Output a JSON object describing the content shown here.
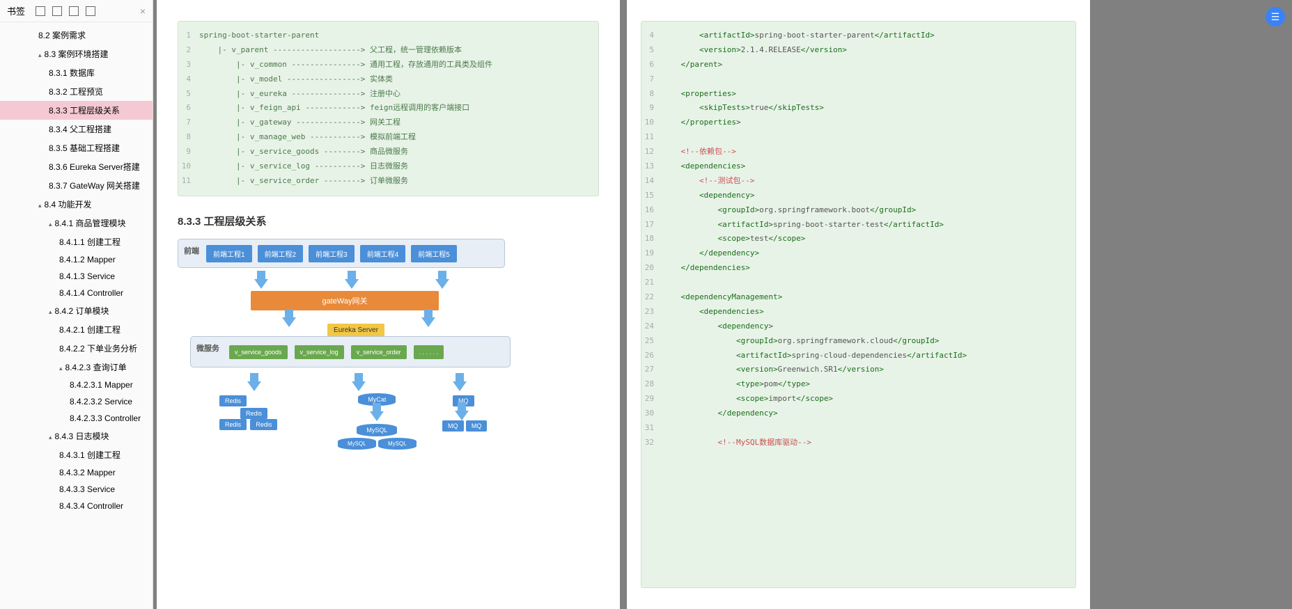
{
  "sidebar": {
    "title": "书签",
    "items": [
      {
        "label": "8.2 案例需求",
        "indent": 1,
        "caret": false
      },
      {
        "label": "8.3 案例环境搭建",
        "indent": 1,
        "caret": true
      },
      {
        "label": "8.3.1 数据库",
        "indent": 2,
        "caret": false
      },
      {
        "label": "8.3.2 工程预览",
        "indent": 2,
        "caret": false
      },
      {
        "label": "8.3.3 工程层级关系",
        "indent": 2,
        "caret": false,
        "active": true
      },
      {
        "label": "8.3.4 父工程搭建",
        "indent": 2,
        "caret": false
      },
      {
        "label": "8.3.5 基础工程搭建",
        "indent": 2,
        "caret": false
      },
      {
        "label": "8.3.6 Eureka Server搭建",
        "indent": 2,
        "caret": false
      },
      {
        "label": "8.3.7 GateWay 网关搭建",
        "indent": 2,
        "caret": false
      },
      {
        "label": "8.4 功能开发",
        "indent": 1,
        "caret": true
      },
      {
        "label": "8.4.1 商品管理模块",
        "indent": 2,
        "caret": true
      },
      {
        "label": "8.4.1.1 创建工程",
        "indent": 3,
        "caret": false
      },
      {
        "label": "8.4.1.2 Mapper",
        "indent": 3,
        "caret": false
      },
      {
        "label": "8.4.1.3 Service",
        "indent": 3,
        "caret": false
      },
      {
        "label": "8.4.1.4 Controller",
        "indent": 3,
        "caret": false
      },
      {
        "label": "8.4.2 订单模块",
        "indent": 2,
        "caret": true
      },
      {
        "label": "8.4.2.1 创建工程",
        "indent": 3,
        "caret": false
      },
      {
        "label": "8.4.2.2 下单业务分析",
        "indent": 3,
        "caret": false
      },
      {
        "label": "8.4.2.3 查询订单",
        "indent": 3,
        "caret": true
      },
      {
        "label": "8.4.2.3.1 Mapper",
        "indent": 4,
        "caret": false
      },
      {
        "label": "8.4.2.3.2 Service",
        "indent": 4,
        "caret": false
      },
      {
        "label": "8.4.2.3.3 Controller",
        "indent": 4,
        "caret": false
      },
      {
        "label": "8.4.3 日志模块",
        "indent": 2,
        "caret": true
      },
      {
        "label": "8.4.3.1 创建工程",
        "indent": 3,
        "caret": false
      },
      {
        "label": "8.4.3.2 Mapper",
        "indent": 3,
        "caret": false
      },
      {
        "label": "8.4.3.3 Service",
        "indent": 3,
        "caret": false
      },
      {
        "label": "8.4.3.4 Controller",
        "indent": 3,
        "caret": false
      }
    ]
  },
  "left_code": [
    {
      "n": "1",
      "t": "spring-boot-starter-parent"
    },
    {
      "n": "2",
      "t": "    |- v_parent -------------------> 父工程，统一管理依赖版本"
    },
    {
      "n": "3",
      "t": "        |- v_common ---------------> 通用工程，存放通用的工具类及组件"
    },
    {
      "n": "4",
      "t": "        |- v_model ----------------> 实体类"
    },
    {
      "n": "5",
      "t": "        |- v_eureka ---------------> 注册中心"
    },
    {
      "n": "6",
      "t": "        |- v_feign_api ------------> feign远程调用的客户端接口"
    },
    {
      "n": "7",
      "t": "        |- v_gateway --------------> 网关工程"
    },
    {
      "n": "8",
      "t": "        |- v_manage_web -----------> 模拟前端工程"
    },
    {
      "n": "9",
      "t": "        |- v_service_goods --------> 商品微服务"
    },
    {
      "n": "10",
      "t": "        |- v_service_log ----------> 日志微服务"
    },
    {
      "n": "11",
      "t": "        |- v_service_order --------> 订单微服务"
    }
  ],
  "section_title": "8.3.3 工程层级关系",
  "diagram": {
    "frontend_label": "前端",
    "frontend_boxes": [
      "前端工程1",
      "前端工程2",
      "前端工程3",
      "前端工程4",
      "前端工程5"
    ],
    "gateway": "gateWay网关",
    "eureka": "Eureka Server",
    "micro_label": "微服务",
    "services": [
      "v_service_goods",
      "v_service_log",
      "v_service_order",
      ". . . . . ."
    ],
    "redis": "Redis",
    "mycat": "MyCat",
    "mysql": "MySQL",
    "mq": "MQ"
  },
  "right_code": [
    {
      "n": "4",
      "html": "        <span class='tag'>&lt;artifactId&gt;</span><span class='text'>spring-boot-starter-parent</span><span class='tag'>&lt;/artifactId&gt;</span>"
    },
    {
      "n": "5",
      "html": "        <span class='tag'>&lt;version&gt;</span><span class='text'>2.1.4.RELEASE</span><span class='tag'>&lt;/version&gt;</span>"
    },
    {
      "n": "6",
      "html": "    <span class='tag'>&lt;/parent&gt;</span>"
    },
    {
      "n": "7",
      "html": ""
    },
    {
      "n": "8",
      "html": "    <span class='tag'>&lt;properties&gt;</span>"
    },
    {
      "n": "9",
      "html": "        <span class='tag'>&lt;skipTests&gt;</span><span class='text'>true</span><span class='tag'>&lt;/skipTests&gt;</span>"
    },
    {
      "n": "10",
      "html": "    <span class='tag'>&lt;/properties&gt;</span>"
    },
    {
      "n": "11",
      "html": ""
    },
    {
      "n": "12",
      "html": "    <span class='comment'>&lt;!--依赖包--&gt;</span>"
    },
    {
      "n": "13",
      "html": "    <span class='tag'>&lt;dependencies&gt;</span>"
    },
    {
      "n": "14",
      "html": "        <span class='comment'>&lt;!--测试包--&gt;</span>"
    },
    {
      "n": "15",
      "html": "        <span class='tag'>&lt;dependency&gt;</span>"
    },
    {
      "n": "16",
      "html": "            <span class='tag'>&lt;groupId&gt;</span><span class='text'>org.springframework.boot</span><span class='tag'>&lt;/groupId&gt;</span>"
    },
    {
      "n": "17",
      "html": "            <span class='tag'>&lt;artifactId&gt;</span><span class='text'>spring-boot-starter-test</span><span class='tag'>&lt;/artifactId&gt;</span>"
    },
    {
      "n": "18",
      "html": "            <span class='tag'>&lt;scope&gt;</span><span class='text'>test</span><span class='tag'>&lt;/scope&gt;</span>"
    },
    {
      "n": "19",
      "html": "        <span class='tag'>&lt;/dependency&gt;</span>"
    },
    {
      "n": "20",
      "html": "    <span class='tag'>&lt;/dependencies&gt;</span>"
    },
    {
      "n": "21",
      "html": ""
    },
    {
      "n": "22",
      "html": "    <span class='tag'>&lt;dependencyManagement&gt;</span>"
    },
    {
      "n": "23",
      "html": "        <span class='tag'>&lt;dependencies&gt;</span>"
    },
    {
      "n": "24",
      "html": "            <span class='tag'>&lt;dependency&gt;</span>"
    },
    {
      "n": "25",
      "html": "                <span class='tag'>&lt;groupId&gt;</span><span class='text'>org.springframework.cloud</span><span class='tag'>&lt;/groupId&gt;</span>"
    },
    {
      "n": "26",
      "html": "                <span class='tag'>&lt;artifactId&gt;</span><span class='text'>spring-cloud-dependencies</span><span class='tag'>&lt;/artifactId&gt;</span>"
    },
    {
      "n": "27",
      "html": "                <span class='tag'>&lt;version&gt;</span><span class='text'>Greenwich.SR1</span><span class='tag'>&lt;/version&gt;</span>"
    },
    {
      "n": "28",
      "html": "                <span class='tag'>&lt;type&gt;</span><span class='text'>pom</span><span class='tag'>&lt;/type&gt;</span>"
    },
    {
      "n": "29",
      "html": "                <span class='tag'>&lt;scope&gt;</span><span class='text'>import</span><span class='tag'>&lt;/scope&gt;</span>"
    },
    {
      "n": "30",
      "html": "            <span class='tag'>&lt;/dependency&gt;</span>"
    },
    {
      "n": "31",
      "html": ""
    },
    {
      "n": "32",
      "html": "            <span class='comment'>&lt;!--MySQL数据库驱动--&gt;</span>"
    }
  ]
}
